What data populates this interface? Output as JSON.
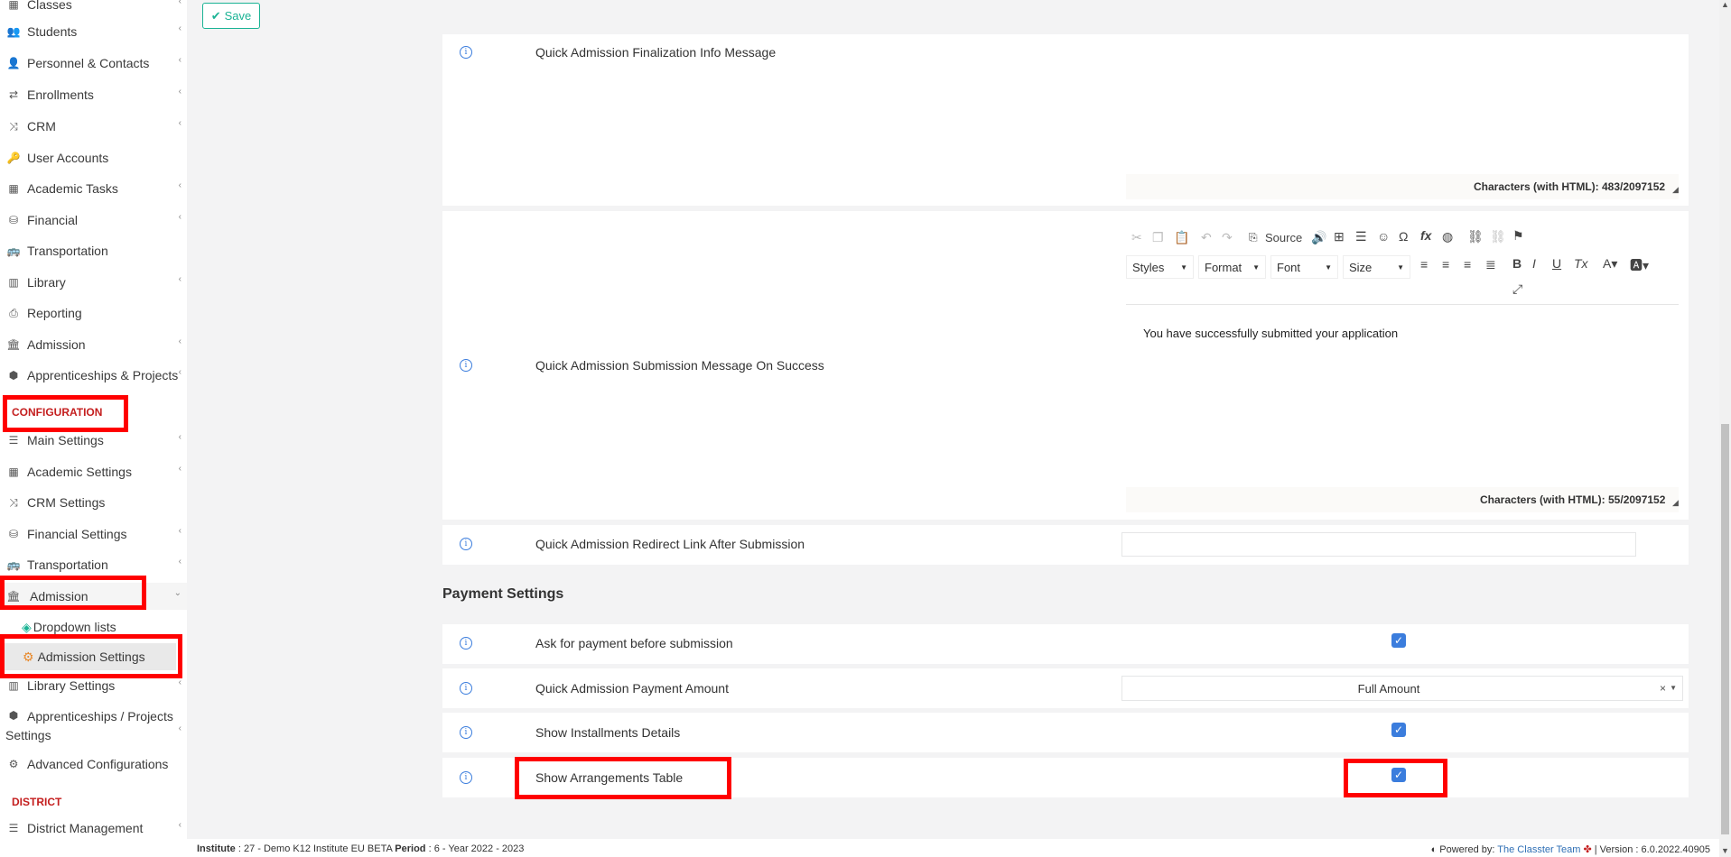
{
  "sidebar": {
    "items": [
      {
        "label": "Classes",
        "icon": "classes-icon",
        "chevron": true
      },
      {
        "label": "Students",
        "icon": "students-icon",
        "chevron": true
      },
      {
        "label": "Personnel & Contacts",
        "icon": "personnel-icon",
        "chevron": true
      },
      {
        "label": "Enrollments",
        "icon": "enrollments-icon",
        "chevron": true
      },
      {
        "label": "CRM",
        "icon": "crm-icon",
        "chevron": true
      },
      {
        "label": "User Accounts",
        "icon": "key-icon",
        "chevron": false
      },
      {
        "label": "Academic Tasks",
        "icon": "grid-icon",
        "chevron": true
      },
      {
        "label": "Financial",
        "icon": "coins-icon",
        "chevron": true
      },
      {
        "label": "Transportation",
        "icon": "bus-icon",
        "chevron": false
      },
      {
        "label": "Library",
        "icon": "books-icon",
        "chevron": true
      },
      {
        "label": "Reporting",
        "icon": "printer-icon",
        "chevron": false
      },
      {
        "label": "Admission",
        "icon": "institution-icon",
        "chevron": true
      },
      {
        "label": "Apprenticeships & Projects",
        "icon": "cube-icon",
        "chevron": true
      }
    ],
    "config_heading": "CONFIGURATION",
    "config_items": [
      {
        "label": "Main Settings",
        "icon": "sliders-icon",
        "chevron": true
      },
      {
        "label": "Academic Settings",
        "icon": "classes-icon",
        "chevron": true
      },
      {
        "label": "CRM Settings",
        "icon": "crm-icon",
        "chevron": false
      },
      {
        "label": "Financial Settings",
        "icon": "coins-icon",
        "chevron": true
      },
      {
        "label": "Transportation",
        "icon": "bus-icon",
        "chevron": true
      },
      {
        "label": "Admission",
        "icon": "institution-icon",
        "chevron": "down"
      }
    ],
    "admission_sub": [
      "Dropdown lists",
      "Admission Settings"
    ],
    "config_items_2": [
      {
        "label": "Library Settings",
        "icon": "books-icon",
        "chevron": true
      },
      {
        "label": "Apprenticeships / Projects",
        "label2": "Settings",
        "icon": "cube-icon",
        "chevron": true
      },
      {
        "label": "Advanced Configurations",
        "icon": "gears-icon",
        "chevron": false
      }
    ],
    "district_heading": "DISTRICT",
    "district_items": [
      {
        "label": "District Management",
        "icon": "list-icon",
        "chevron": true
      }
    ]
  },
  "toolbar": {
    "save_label": "Save"
  },
  "settings": {
    "row1_label": "Quick Admission Finalization Info Message",
    "row1_count": "Characters (with HTML): 483/2097152",
    "row2_label": "Quick Admission Submission Message On Success",
    "row2_content": "You have successfully submitted your application",
    "row2_count": "Characters (with HTML): 55/2097152",
    "row3_label": "Quick Admission Redirect Link After Submission",
    "row3_value": ""
  },
  "editor": {
    "source_label": "Source",
    "styles_label": "Styles",
    "format_label": "Format",
    "font_label": "Font",
    "size_label": "Size"
  },
  "payment": {
    "title": "Payment Settings",
    "rows": [
      {
        "label": "Ask for payment before submission",
        "type": "checkbox",
        "checked": true
      },
      {
        "label": "Quick Admission Payment Amount",
        "type": "select",
        "value": "Full Amount"
      },
      {
        "label": "Show Installments Details",
        "type": "checkbox",
        "checked": true
      },
      {
        "label": "Show Arrangements Table",
        "type": "checkbox",
        "checked": true
      }
    ]
  },
  "footer": {
    "institute_label": "Institute",
    "institute_value": ": 27 - Demo K12 Institute EU BETA",
    "period_label": "Period",
    "period_value": ": 6 - Year 2022 - 2023",
    "powered_label": "Powered by:",
    "powered_link": "The Classter Team",
    "version": "| Version : 6.0.2022.40905"
  },
  "colors": {
    "accent": "#1ab394",
    "checkbox": "#3b7ddd",
    "config_heading": "#c41e1e",
    "highlight_box": "#ff0000"
  }
}
